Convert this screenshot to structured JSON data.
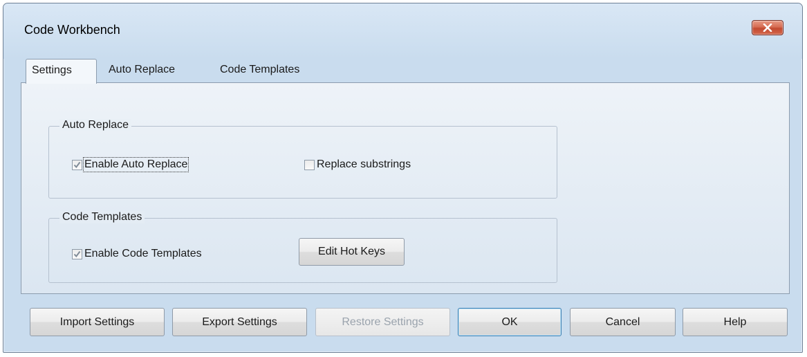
{
  "window": {
    "title": "Code Workbench"
  },
  "tabs": [
    {
      "label": "Settings",
      "selected": true
    },
    {
      "label": "Auto Replace",
      "selected": false
    },
    {
      "label": "Code Templates",
      "selected": false
    }
  ],
  "groups": {
    "auto_replace": {
      "label": "Auto Replace",
      "enable_label": "Enable Auto Replace",
      "enable_checked": true,
      "substrings_label": "Replace substrings",
      "substrings_checked": false
    },
    "code_templates": {
      "label": "Code Templates",
      "enable_label": "Enable Code Templates",
      "enable_checked": true,
      "edit_hotkeys_label": "Edit Hot Keys"
    }
  },
  "buttons": {
    "import": "Import Settings",
    "export": "Export Settings",
    "restore": "Restore Settings",
    "ok": "OK",
    "cancel": "Cancel",
    "help": "Help"
  },
  "colors": {
    "dialog_background": "#c9dcee",
    "close_button": "#d66d53",
    "disabled_text": "#9aa3ad"
  },
  "icons": [
    "close-icon",
    "checkmark-icon"
  ]
}
